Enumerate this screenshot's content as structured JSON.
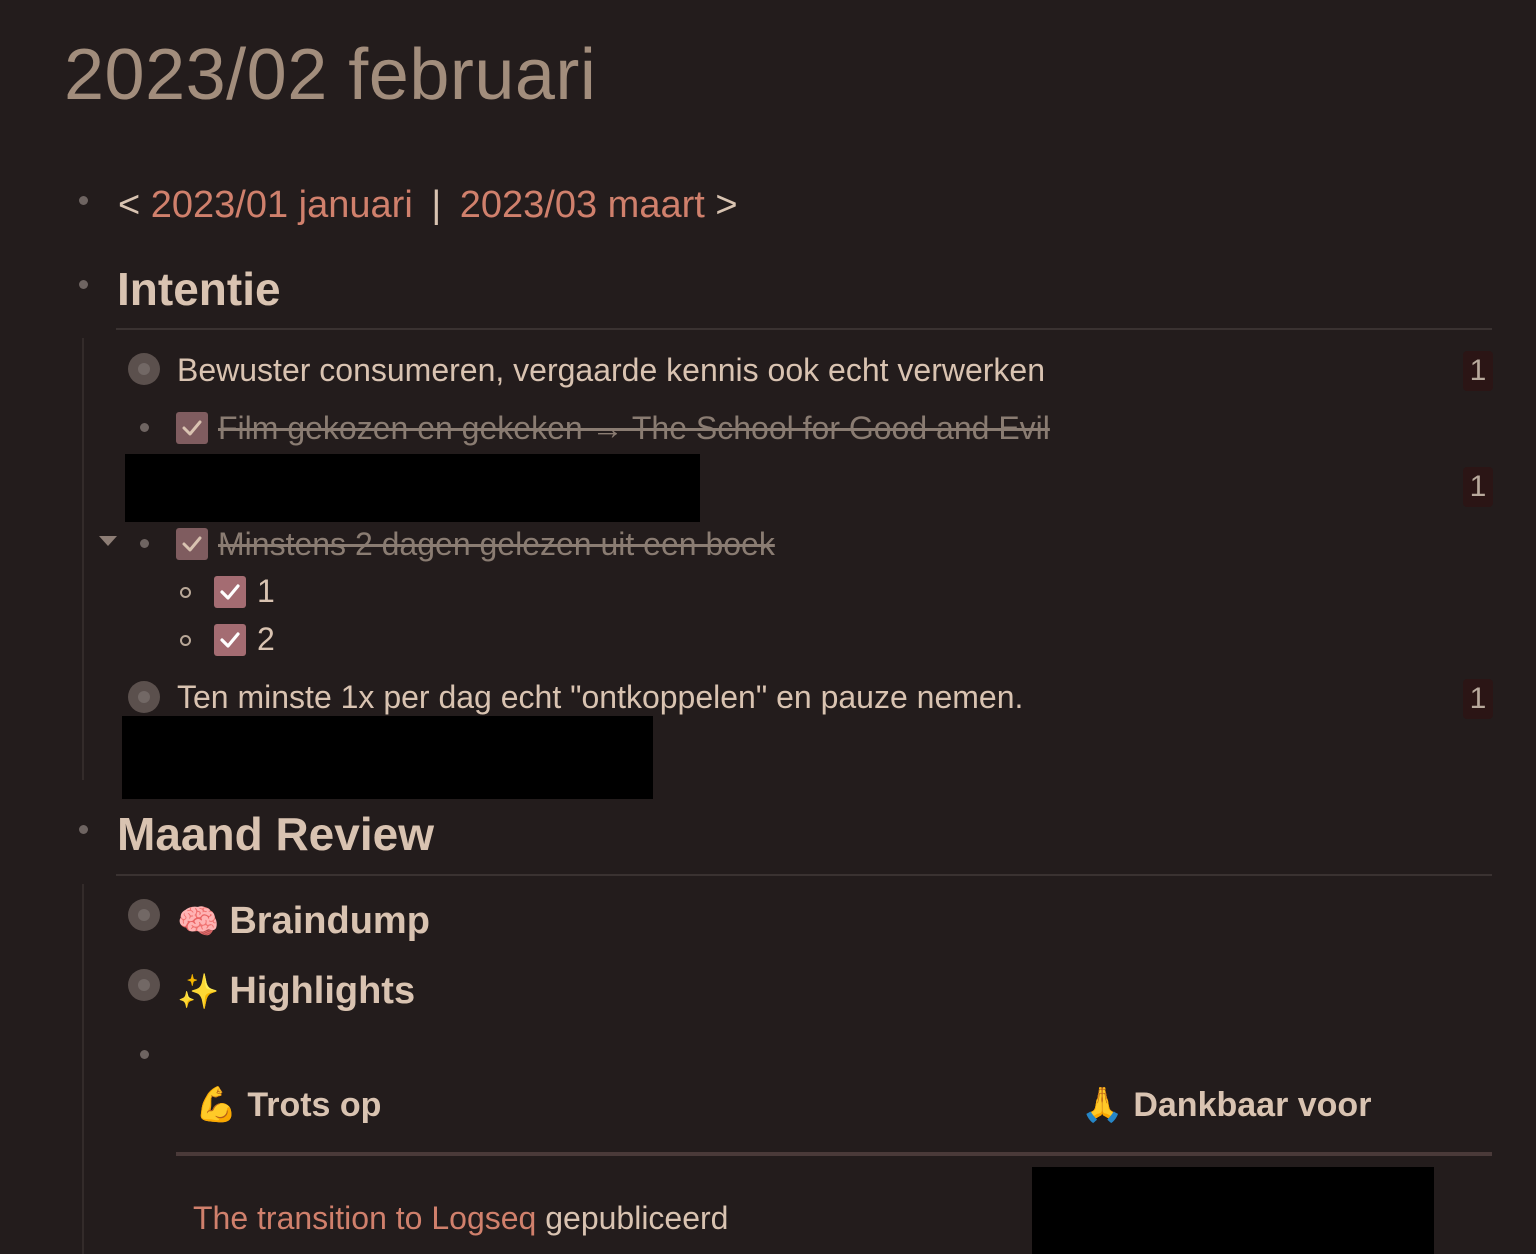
{
  "page": {
    "title": "2023/02 februari"
  },
  "nav": {
    "prefix": "<",
    "prev_link": "2023/01 januari",
    "separator": "|",
    "next_link": "2023/03 maart",
    "suffix": ">"
  },
  "intentie": {
    "heading": "Intentie",
    "items": [
      {
        "text": "Bewuster consumeren, vergaarde kennis ook echt verwerken",
        "ref_count": "1"
      },
      {
        "text": "Film gekozen en gekeken → The School for Good and Evil",
        "done": true
      },
      {
        "ref_count": "1"
      },
      {
        "text": "Minstens 2 dagen gelezen uit een boek",
        "done": true,
        "children": [
          {
            "text": "1",
            "done": true
          },
          {
            "text": "2",
            "done": true
          }
        ]
      },
      {
        "text": "Ten minste 1x per dag echt \"ontkoppelen\" en pauze nemen.",
        "ref_count": "1"
      }
    ]
  },
  "review": {
    "heading": "Maand Review",
    "braindump": {
      "emoji": "🧠",
      "label": "Braindump"
    },
    "highlights": {
      "emoji": "✨",
      "label": "Highlights"
    },
    "table": {
      "col1": {
        "emoji": "💪",
        "label": "Trots op"
      },
      "col2": {
        "emoji": "🙏",
        "label": "Dankbaar voor"
      },
      "row1": {
        "link": "The transition to Logseq",
        "text": " gepubliceerd"
      }
    }
  }
}
